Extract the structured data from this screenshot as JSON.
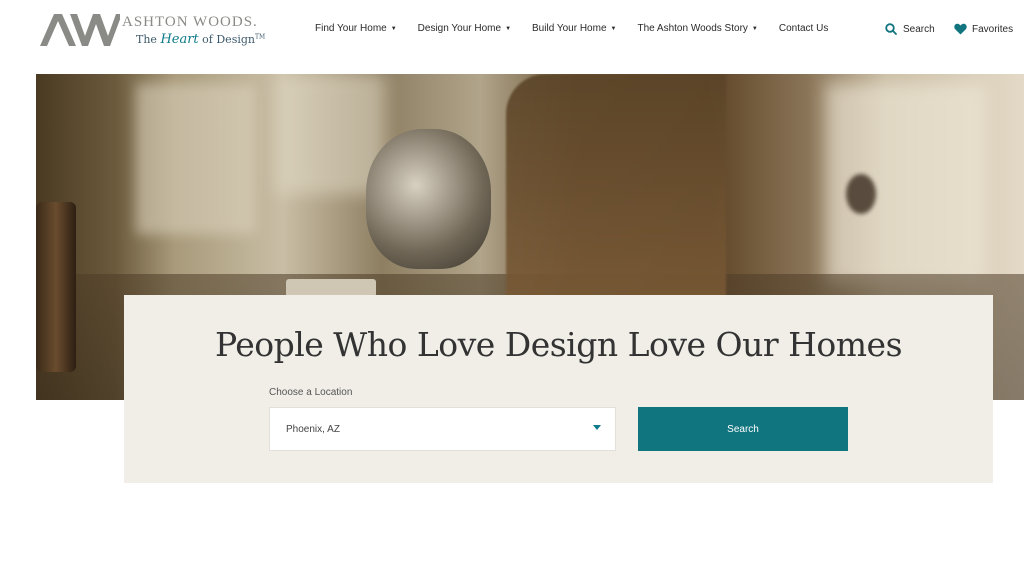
{
  "brand": {
    "monogram": "AW",
    "name": "ASHTON WOODS.",
    "tagline_pre": "The ",
    "tagline_heart": "Heart",
    "tagline_post": " of Design",
    "tagline_tm": "TM"
  },
  "nav": {
    "items": [
      {
        "label": "Find Your Home",
        "has_dropdown": true
      },
      {
        "label": "Design Your Home",
        "has_dropdown": true
      },
      {
        "label": "Build Your Home",
        "has_dropdown": true
      },
      {
        "label": "The Ashton Woods Story",
        "has_dropdown": true
      },
      {
        "label": "Contact Us",
        "has_dropdown": false
      }
    ],
    "caret": "▼",
    "search_label": "Search",
    "favorites_label": "Favorites"
  },
  "hero": {
    "image": "woman-pouring-kettle-kitchen-photo"
  },
  "panel": {
    "headline": "People Who Love Design Love Our Homes",
    "location_label": "Choose a Location",
    "location_value": "Phoenix, AZ",
    "search_button": "Search"
  },
  "colors": {
    "accent": "#117580",
    "panel_bg": "#f1eee8",
    "logo_gray": "#8a8a86"
  }
}
